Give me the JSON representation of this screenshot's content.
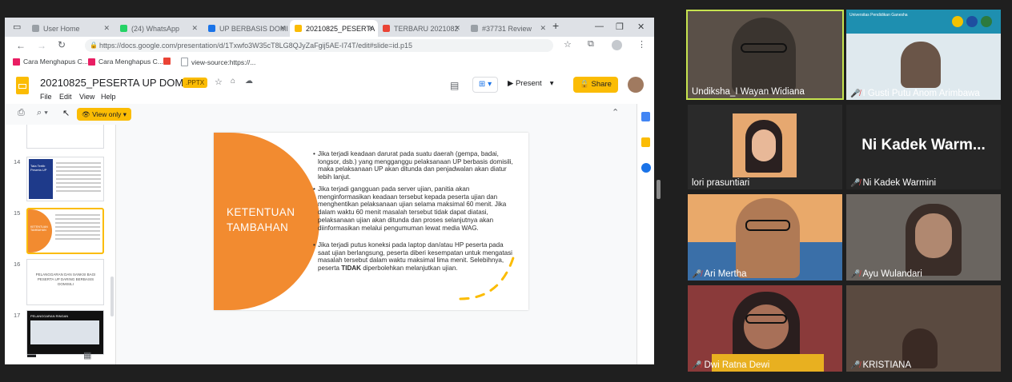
{
  "browser": {
    "tabs": [
      {
        "label": "User Home",
        "color": "#9aa0a6"
      },
      {
        "label": "(24) WhatsApp",
        "color": "#25d366"
      },
      {
        "label": "UP BERBASIS DOMI",
        "color": "#1a73e8"
      },
      {
        "label": "20210825_PESERTA",
        "color": "#fbbc04"
      },
      {
        "label": "TERBARU 2021082",
        "color": "#ea4335"
      },
      {
        "label": "#37731 Review",
        "color": "#9aa0a6"
      }
    ],
    "url": "https://docs.google.com/presentation/d/1Txwfo3W35cT8LG8QJyZaFgij5AE-I74T/edit#slide=id.p15",
    "bookmarks": [
      {
        "label": "Cara Menghapus C...",
        "color": "#e91e63"
      },
      {
        "label": "Cara Menghapus C...",
        "color": "#e91e63"
      },
      {
        "label": "",
        "color": "#ea4335"
      },
      {
        "label": "view-source:https://...",
        "color": "#9aa0a6"
      }
    ]
  },
  "app": {
    "doc_title": "20210825_PESERTA UP DOMISILI",
    "badge": ".PPTX",
    "menus": [
      "File",
      "Edit",
      "View",
      "Help"
    ],
    "present_label": "Present",
    "share_label": "Share",
    "view_only_label": "View only",
    "accent_color": "#fbbc04"
  },
  "filmstrip": {
    "slides": [
      {
        "number": "14",
        "text": "Tata Tertib Peserta UP"
      },
      {
        "number": "15",
        "text": "KETENTUAN TAMBAHAN"
      },
      {
        "number": "16",
        "text": "PELANGGARAN DAN SANKSI BAGI PESERTA UP DARING BERBASIS DOMISILI"
      },
      {
        "number": "17",
        "text": "PELANGGARAN RINGAN"
      }
    ]
  },
  "slide": {
    "heading_line1": "KETENTUAN",
    "heading_line2": "TAMBAHAN",
    "bullets": [
      "Jika terjadi keadaan darurat pada suatu daerah (gempa, badai, longsor, dsb.) yang mengganggu pelaksanaan UP berbasis domisili, maka pelaksanaan UP akan ditunda dan penjadwalan akan diatur lebih lanjut.",
      "Jika terjadi gangguan pada server ujian, panitia akan menginformasikan keadaan tersebut kepada peserta ujian dan menghentikan pelaksanaan ujian selama maksimal 60 menit. Jika dalam waktu 60 menit masalah tersebut tidak dapat diatasi, pelaksanaan ujian akan ditunda dan proses selanjutnya akan diinformasikan melalui pengumuman lewat media WAG.",
      "Jika terjadi putus koneksi pada laptop dan/atau HP peserta pada saat ujian berlangsung, peserta diberi kesempatan untuk mengatasi masalah tersebut dalam waktu maksimal lima menit. Selebihnya, peserta "
    ],
    "bullet3_bold": "TIDAK",
    "bullet3_tail": " diperbolehkan melanjutkan ujian."
  },
  "participants": [
    {
      "name": "Undiksha_I Wayan Widiana",
      "muted": false,
      "bg": "#5a5048"
    },
    {
      "name": "I Gusti Putu Anom Arimbawa",
      "muted": true,
      "bg": "#dfe9ee",
      "logo_text": "Universitas Pendidikan Ganesha"
    },
    {
      "name": "lori prasuntiari",
      "muted": false,
      "bg": "#2a2a2a"
    },
    {
      "name": "Ni Kadek Warmini",
      "muted": true,
      "bg": "#262626",
      "placeholder": "Ni Kadek Warm..."
    },
    {
      "name": "Ari Mertha",
      "muted": true,
      "bg": "#3a6fa8"
    },
    {
      "name": "Ayu Wulandari",
      "muted": true,
      "bg": "#6a6560"
    },
    {
      "name": "Dwi Ratna Dewi",
      "muted": true,
      "bg": "#8a3a3a"
    },
    {
      "name": "KRISTIANA",
      "muted": true,
      "bg": "#5a4a40"
    }
  ]
}
